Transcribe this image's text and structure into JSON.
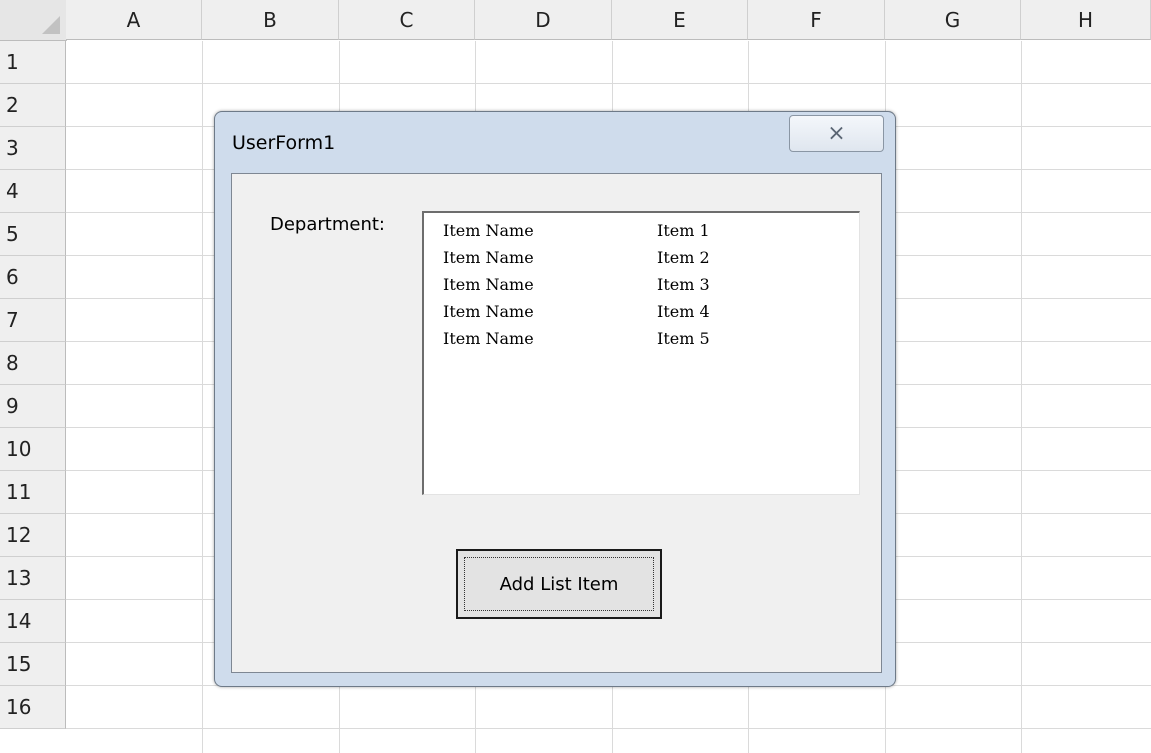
{
  "sheet": {
    "columns": [
      "A",
      "B",
      "C",
      "D",
      "E",
      "F",
      "G",
      "H"
    ],
    "rows": [
      "1",
      "2",
      "3",
      "4",
      "5",
      "6",
      "7",
      "8",
      "9",
      "10",
      "11",
      "12",
      "13",
      "14",
      "15",
      "16"
    ]
  },
  "userform": {
    "title": "UserForm1",
    "close_glyph": "⨯",
    "department_label": "Department:",
    "list_items": [
      {
        "name": "Item Name",
        "value": "Item 1"
      },
      {
        "name": "Item Name",
        "value": "Item 2"
      },
      {
        "name": "Item Name",
        "value": "Item 3"
      },
      {
        "name": "Item Name",
        "value": "Item 4"
      },
      {
        "name": "Item Name",
        "value": "Item 5"
      }
    ],
    "add_button_label": "Add List Item"
  }
}
